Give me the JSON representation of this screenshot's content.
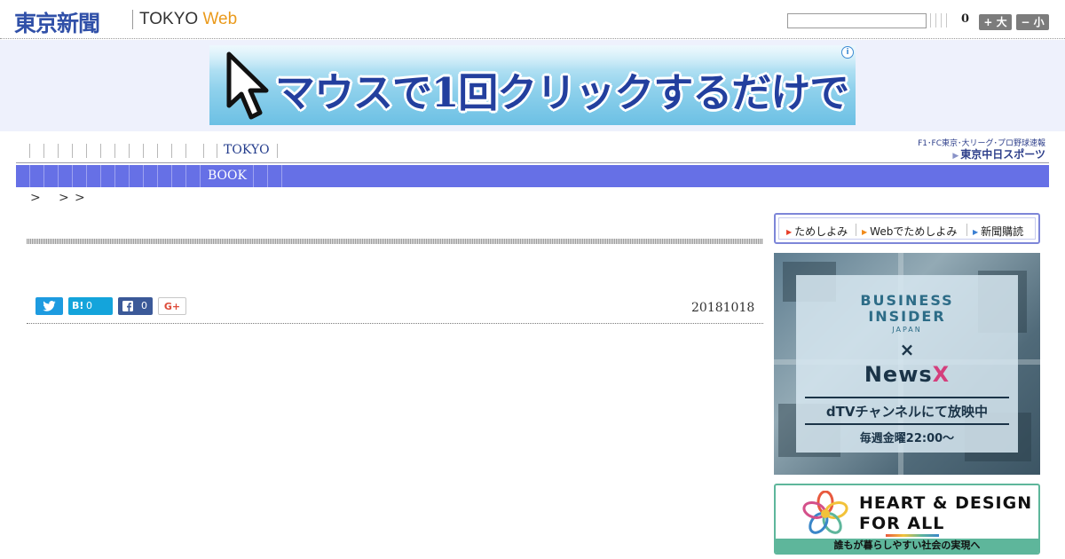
{
  "header": {
    "logo_main": "東京新聞",
    "logo_sub": "TOKYO",
    "logo_sub_accent": "Web",
    "search_value": "",
    "result_count": "0",
    "font_large_label": "+ 大",
    "font_small_label": "− 小"
  },
  "banner_ad": {
    "text": "マウスで1回クリックするだけで",
    "info_icon": "i"
  },
  "nav": {
    "tokyo_label": "TOKYO",
    "book_label": "BOOK",
    "sister_tagline": "F1･FC東京･大リーグ･プロ野球速報",
    "sister_logo": "東京中日スポーツ"
  },
  "breadcrumb": [
    ">",
    ">",
    ">"
  ],
  "article": {
    "date": "20181018",
    "share": {
      "hatena_icon": "B!",
      "hatena_count": "0",
      "facebook_count": "0",
      "gplus_label": "G+"
    }
  },
  "sidebar": {
    "subscribe": [
      "ためしよみ",
      "Webでためしよみ",
      "新聞購読"
    ],
    "subscribe_colors": [
      "#e8402a",
      "#f08a1c",
      "#3b7fd2"
    ],
    "bi_ad": {
      "line1": "BUSINESS",
      "line2": "INSIDER",
      "japan": "JAPAN",
      "cross": "×",
      "brand": "News",
      "brand_accent": "X",
      "broadcast": "dTVチャンネルにて放映中",
      "schedule": "毎週金曜22:00〜"
    },
    "hd_ad": {
      "title_line1": "HEART & DESIGN",
      "title_line2": "FOR ALL",
      "tagline": "誰もが暮らしやすい社会の実現へ"
    }
  },
  "colors": {
    "brand_blue": "#3050a8",
    "nav_bar": "#6670e6",
    "accent_orange": "#ea9a1c"
  }
}
